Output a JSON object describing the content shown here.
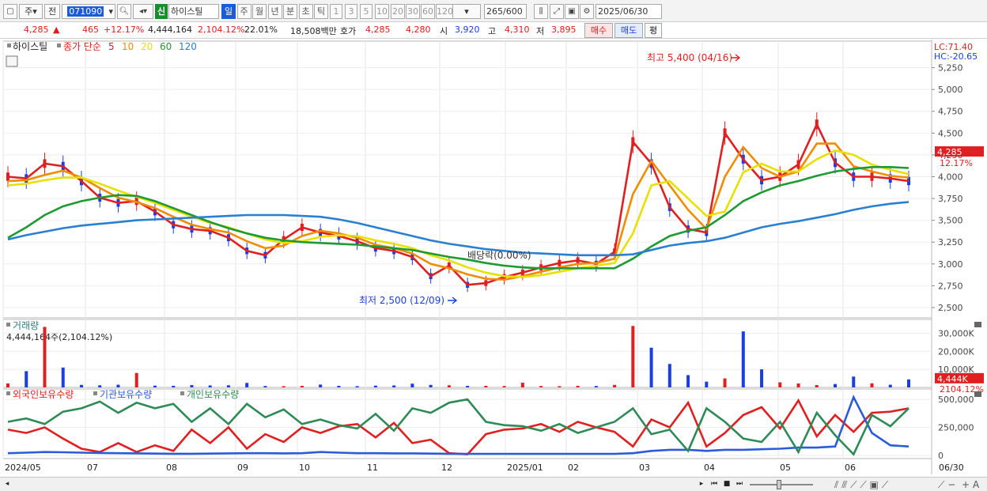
{
  "toolbar": {
    "market_label": "주",
    "prev_label": "전",
    "code_value": "071090",
    "stock_name": "하이스틸",
    "new_badge": "신",
    "periods": [
      "일",
      "주",
      "월",
      "년",
      "분",
      "초",
      "틱"
    ],
    "active_period": "일",
    "intervals": [
      "1",
      "3",
      "5",
      "10",
      "20",
      "30",
      "60",
      "120"
    ],
    "count_value": "265",
    "count_total": "/600",
    "date_value": "2025/06/30"
  },
  "quote": {
    "price": "4,285",
    "change_arrow": "▲",
    "change": "465",
    "change_pct": "+12.17%",
    "volume": "4,444,164",
    "volume_pct": "2,104.12%",
    "turnover": "22.01%",
    "amount": "18,508백만",
    "ask_label": "호가",
    "ask1": "4,285",
    "ask2": "4,280",
    "open_label": "시",
    "open": "3,920",
    "high_label": "고",
    "high": "4,310",
    "low_label": "저",
    "low": "3,895",
    "buy_label": "매수",
    "sell_label": "매도",
    "eval_label": "평"
  },
  "price_panel": {
    "stock_label": "하이스틸",
    "ma_title": "종가 단순",
    "ma_periods": [
      {
        "label": "5",
        "color": "#e02020"
      },
      {
        "label": "10",
        "color": "#f08c00"
      },
      {
        "label": "20",
        "color": "#e8e000"
      },
      {
        "label": "60",
        "color": "#1e9a32"
      },
      {
        "label": "120",
        "color": "#2a7fd0"
      }
    ],
    "lc": "LC:71.40",
    "hc": "HC:-20.65",
    "y_ticks": [
      "5,250",
      "5,000",
      "4,750",
      "4,500",
      "4,250",
      "4,000",
      "3,750",
      "3,500",
      "3,250",
      "3,000",
      "2,750",
      "2,500"
    ],
    "current_price_tag": "4,285",
    "current_pct_tag": "12.17%",
    "high_annotation": "최고 5,400 (04/16)",
    "low_annotation": "최저 2,500 (12/09)",
    "dividend_annotation": "배당락(0.00%)"
  },
  "volume_panel": {
    "title": "거래량",
    "value_text": "4,444,164주(2,104.12%)",
    "y_ticks": [
      "30,000K",
      "20,000K",
      "10,000K"
    ],
    "current_tag": "4,444K",
    "current_pct_tag": "2104.12%"
  },
  "holdings_panel": {
    "series": [
      {
        "name": "외국인보유수량",
        "color": "#e02020"
      },
      {
        "name": "기관보유수량",
        "color": "#2a5bd8"
      },
      {
        "name": "개인보유수량",
        "color": "#2e8b57"
      }
    ],
    "y_ticks": [
      "500,000",
      "250,000",
      "0"
    ]
  },
  "x_axis": {
    "labels": [
      "2024/05",
      "07",
      "08",
      "09",
      "10",
      "11",
      "12",
      "2025/01",
      "02",
      "03",
      "04",
      "05",
      "06"
    ],
    "right_label": "06/30"
  },
  "chart_data": [
    {
      "type": "line",
      "title": "",
      "price_range": [
        2500,
        5400
      ],
      "series": [
        {
          "name": "5",
          "values": [
            4000,
            3980,
            4150,
            4120,
            3950,
            3760,
            3700,
            3720,
            3600,
            3450,
            3400,
            3380,
            3300,
            3150,
            3100,
            3280,
            3420,
            3360,
            3320,
            3260,
            3180,
            3150,
            3080,
            2860,
            2980,
            2760,
            2780,
            2850,
            2900,
            2960,
            3010,
            3040,
            3000,
            3140,
            4400,
            4150,
            3650,
            3400,
            3360,
            4500,
            4200,
            3960,
            4000,
            4140,
            4600,
            4160,
            4000,
            4000,
            3980,
            3950
          ]
        },
        {
          "name": "10",
          "values": [
            3950,
            3960,
            4020,
            4070,
            3990,
            3870,
            3760,
            3710,
            3640,
            3540,
            3450,
            3400,
            3360,
            3260,
            3180,
            3210,
            3320,
            3380,
            3350,
            3300,
            3220,
            3180,
            3120,
            3000,
            2950,
            2880,
            2830,
            2820,
            2860,
            2910,
            2960,
            3000,
            3010,
            3060,
            3800,
            4180,
            3900,
            3620,
            3400,
            4000,
            4340,
            4100,
            4000,
            4060,
            4380,
            4380,
            4120,
            4060,
            4010,
            3990
          ]
        },
        {
          "name": "20",
          "values": [
            3900,
            3920,
            3960,
            3990,
            3990,
            3920,
            3840,
            3770,
            3700,
            3620,
            3540,
            3470,
            3420,
            3350,
            3280,
            3240,
            3260,
            3310,
            3330,
            3320,
            3270,
            3230,
            3180,
            3100,
            3040,
            2960,
            2900,
            2860,
            2850,
            2870,
            2910,
            2950,
            2980,
            3010,
            3350,
            3900,
            3950,
            3750,
            3550,
            3600,
            4050,
            4150,
            4060,
            4060,
            4200,
            4300,
            4250,
            4140,
            4080,
            4030
          ]
        },
        {
          "name": "60",
          "values": [
            3300,
            3420,
            3560,
            3660,
            3720,
            3760,
            3790,
            3780,
            3720,
            3640,
            3560,
            3480,
            3410,
            3350,
            3300,
            3270,
            3250,
            3240,
            3230,
            3220,
            3200,
            3180,
            3160,
            3120,
            3080,
            3050,
            3010,
            2980,
            2960,
            2950,
            2950,
            2950,
            2950,
            2950,
            3060,
            3200,
            3320,
            3380,
            3420,
            3560,
            3720,
            3820,
            3900,
            3950,
            4010,
            4060,
            4090,
            4110,
            4110,
            4100
          ]
        },
        {
          "name": "120",
          "values": [
            3280,
            3330,
            3370,
            3410,
            3440,
            3460,
            3480,
            3500,
            3510,
            3520,
            3530,
            3540,
            3550,
            3560,
            3560,
            3560,
            3550,
            3540,
            3510,
            3470,
            3420,
            3370,
            3320,
            3270,
            3230,
            3200,
            3170,
            3150,
            3130,
            3120,
            3110,
            3100,
            3100,
            3100,
            3110,
            3160,
            3210,
            3240,
            3260,
            3300,
            3360,
            3420,
            3460,
            3490,
            3530,
            3570,
            3620,
            3660,
            3690,
            3710
          ]
        }
      ]
    },
    {
      "type": "bar",
      "title": "거래량",
      "ylim": [
        0,
        35000
      ],
      "unit": "K",
      "series": [
        {
          "name": "거래량",
          "values": [
            2200,
            9000,
            33500,
            11000,
            1400,
            1200,
            1500,
            8000,
            1000,
            900,
            1300,
            1100,
            1200,
            2500,
            800,
            700,
            900,
            1600,
            900,
            700,
            1000,
            1100,
            2100,
            1400,
            1200,
            900,
            900,
            800,
            2600,
            800,
            700,
            900,
            800,
            1400,
            34000,
            22000,
            13000,
            6800,
            3200,
            5000,
            31000,
            10000,
            2800,
            2200,
            1300,
            1900,
            6000,
            2300,
            1500,
            4444
          ]
        }
      ]
    },
    {
      "type": "line",
      "title": "",
      "ylim": [
        0,
        550000
      ],
      "series": [
        {
          "name": "외국인보유수량",
          "values": [
            230000,
            200000,
            250000,
            150000,
            60000,
            30000,
            110000,
            30000,
            90000,
            40000,
            230000,
            110000,
            250000,
            60000,
            190000,
            120000,
            250000,
            200000,
            260000,
            280000,
            160000,
            290000,
            110000,
            140000,
            20000,
            10000,
            190000,
            230000,
            240000,
            280000,
            210000,
            300000,
            250000,
            210000,
            80000,
            320000,
            250000,
            470000,
            80000,
            200000,
            360000,
            430000,
            240000,
            490000,
            170000,
            360000,
            210000,
            380000,
            390000,
            420000
          ]
        },
        {
          "name": "기관보유수량",
          "values": [
            20000,
            25000,
            30000,
            28000,
            25000,
            22000,
            20000,
            18000,
            16000,
            15000,
            15000,
            16000,
            18000,
            20000,
            20000,
            18000,
            20000,
            30000,
            25000,
            20000,
            20000,
            18000,
            18000,
            16000,
            15000,
            14000,
            14000,
            14000,
            14000,
            14000,
            14000,
            14000,
            14000,
            14000,
            20000,
            40000,
            50000,
            50000,
            40000,
            50000,
            50000,
            55000,
            60000,
            70000,
            70000,
            80000,
            520000,
            200000,
            90000,
            80000
          ]
        },
        {
          "name": "개인보유수량",
          "values": [
            300000,
            330000,
            280000,
            390000,
            420000,
            480000,
            380000,
            470000,
            420000,
            460000,
            300000,
            420000,
            280000,
            460000,
            340000,
            410000,
            280000,
            320000,
            270000,
            240000,
            370000,
            220000,
            420000,
            380000,
            470000,
            500000,
            300000,
            270000,
            260000,
            220000,
            280000,
            200000,
            250000,
            300000,
            420000,
            190000,
            230000,
            40000,
            420000,
            300000,
            150000,
            120000,
            300000,
            30000,
            380000,
            180000,
            10000,
            360000,
            260000,
            420000
          ]
        }
      ]
    }
  ]
}
